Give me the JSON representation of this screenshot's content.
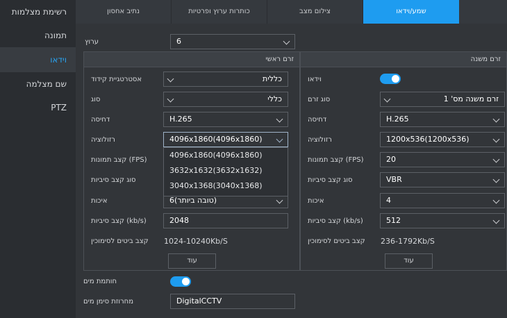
{
  "sidebar": {
    "items": [
      {
        "label": "רשימת מצלמות"
      },
      {
        "label": "תמונה"
      },
      {
        "label": "וידאו"
      },
      {
        "label": "שם מצלמה"
      },
      {
        "label": "PTZ"
      }
    ]
  },
  "tabs": [
    {
      "label": "שמע/וידאו"
    },
    {
      "label": "צילום מצב"
    },
    {
      "label": "כותרות ערוץ ופרטיות"
    },
    {
      "label": "נתיב אחסון"
    }
  ],
  "channel": {
    "label": "ערוץ",
    "value": "6"
  },
  "main_stream": {
    "header": "זרם ראשי",
    "encode_strategy": {
      "label": "אסטרטגיית קידוד",
      "value": "כללית"
    },
    "type": {
      "label": "סוג",
      "value": "כללי"
    },
    "compression": {
      "label": "דחיסה",
      "value": "H.265"
    },
    "resolution": {
      "label": "רזולוציה",
      "value": "4096x1860(4096x1860)"
    },
    "fps": {
      "label": "קצב תמונות (FPS)"
    },
    "bitrate_type": {
      "label": "סוג קצב סיביות"
    },
    "quality": {
      "label": "איכות",
      "value": "6(טובה ביותר)"
    },
    "bitrate": {
      "label": "קצב סיביות (kb/s)",
      "value": "2048"
    },
    "ref_bitrate": {
      "label": "קצב ביטים לסימוכין",
      "value": "1024-10240Kb/S"
    },
    "more_button": "עוד",
    "resolution_options": [
      "4096x1860(4096x1860)",
      "3632x1632(3632x1632)",
      "3040x1368(3040x1368)"
    ]
  },
  "sub_stream": {
    "header": "זרם משנה",
    "video": {
      "label": "וידאו"
    },
    "stream_type": {
      "label": "סוג זרם",
      "value": "זרם משנה מס' 1"
    },
    "compression": {
      "label": "דחיסה",
      "value": "H.265"
    },
    "resolution": {
      "label": "רזולוציה",
      "value": "1200x536(1200x536)"
    },
    "fps": {
      "label": "קצב תמונות (FPS)",
      "value": "20"
    },
    "bitrate_type": {
      "label": "סוג קצב סיביות",
      "value": "VBR"
    },
    "quality": {
      "label": "איכות",
      "value": "4"
    },
    "bitrate": {
      "label": "קצב סיביות (kb/s)",
      "value": "512"
    },
    "ref_bitrate": {
      "label": "קצב ביטים לסימוכין",
      "value": "236-1792Kb/S"
    },
    "more_button": "עוד"
  },
  "watermark": {
    "label": "חותמת מים",
    "string_label": "מחרוזת סימן מים",
    "string_value": "DigitalCCTV"
  },
  "colors": {
    "accent": "#1e9cf0",
    "background": "#323539",
    "sidebar": "#2a2d31"
  }
}
